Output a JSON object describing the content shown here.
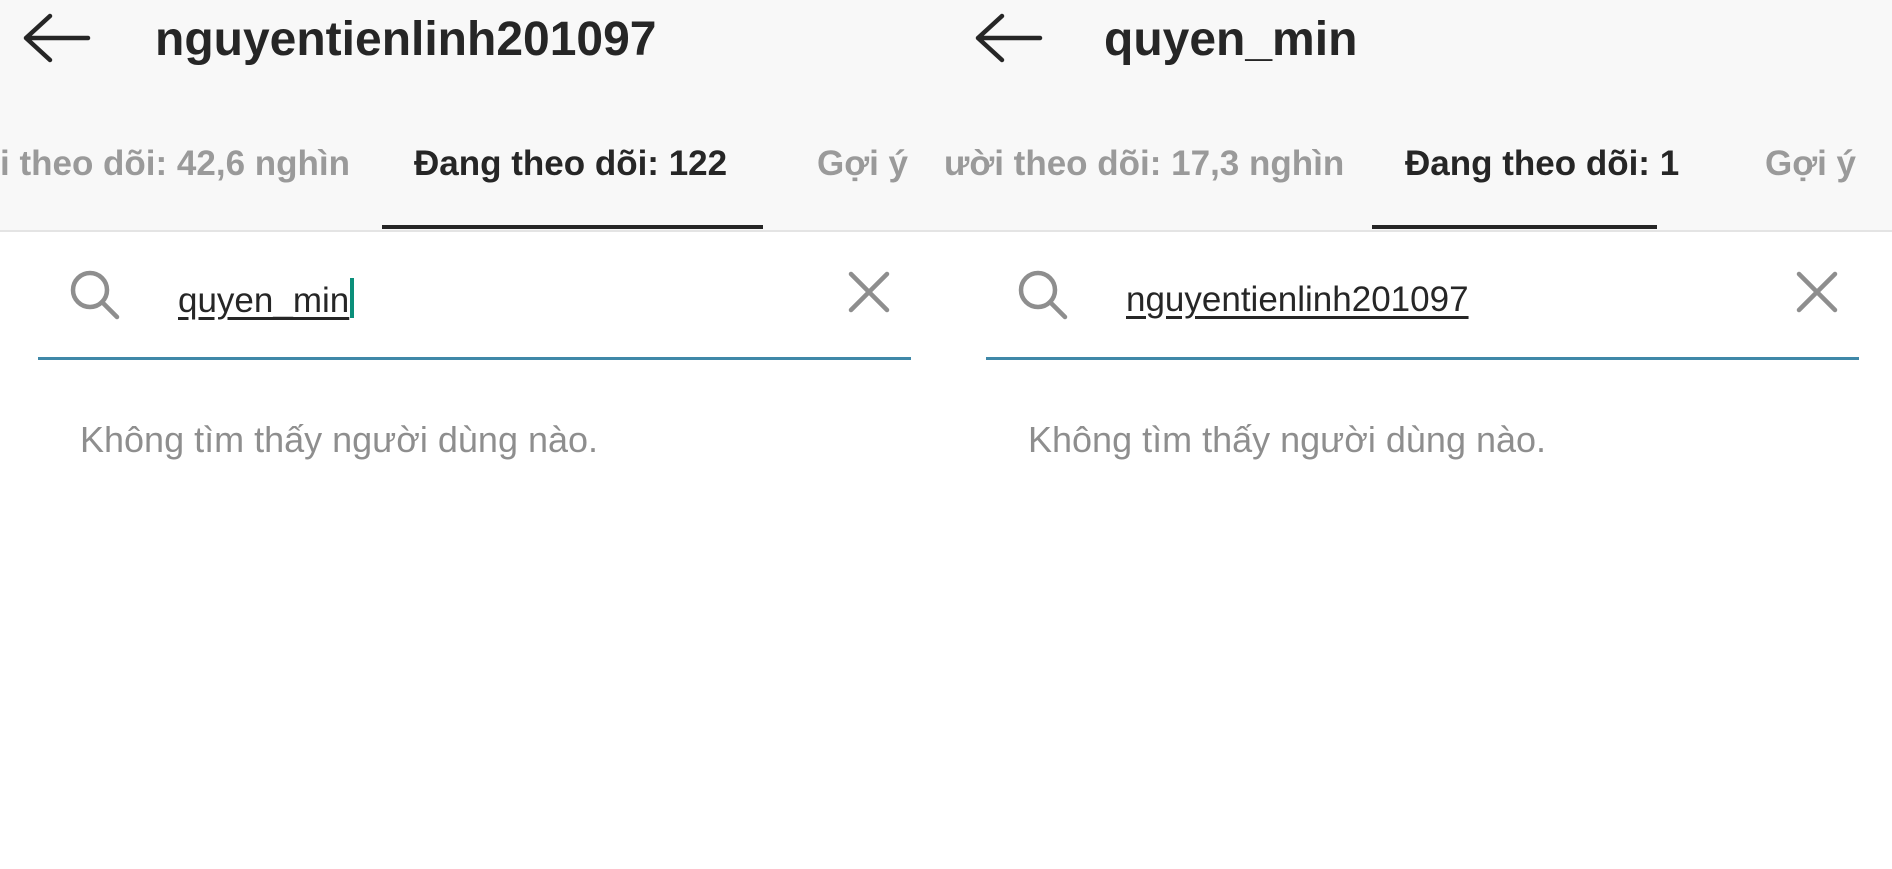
{
  "left": {
    "header": {
      "title": "nguyentienlinh201097"
    },
    "tabs": [
      {
        "label": "i theo dõi: 42,6 nghìn"
      },
      {
        "label": "Đang theo dõi: 122"
      },
      {
        "label": "Gợi ý"
      }
    ],
    "search": {
      "value": "quyen_min"
    },
    "empty_message": "Không tìm thấy người dùng nào."
  },
  "right": {
    "header": {
      "title": "quyen_min"
    },
    "tabs": [
      {
        "label": "ười theo dõi: 17,3 nghìn"
      },
      {
        "label": "Đang theo dõi: 1"
      },
      {
        "label": "Gợi ý"
      }
    ],
    "search": {
      "value": "nguyentienlinh201097"
    },
    "empty_message": "Không tìm thấy người dùng nào."
  },
  "colors": {
    "accent_line": "#3f88a8",
    "caret": "#0b8f7a",
    "text_primary": "#262626",
    "text_muted": "#8e8e8e"
  },
  "icons": [
    "back-arrow-icon",
    "search-icon",
    "close-icon"
  ]
}
